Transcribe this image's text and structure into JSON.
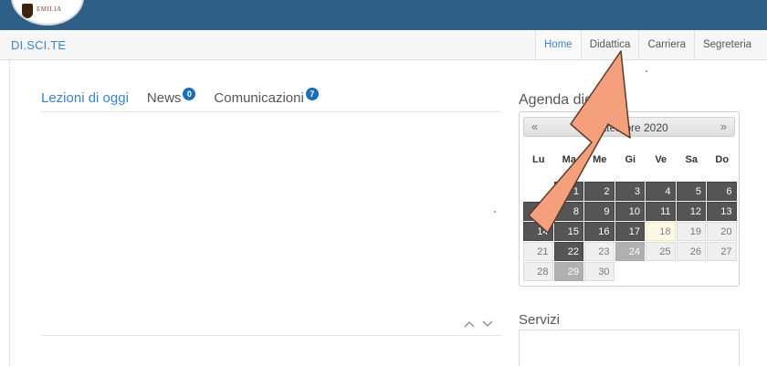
{
  "header": {
    "logo_text": "EMILIA",
    "brand": "DI.SCI.TE"
  },
  "nav": {
    "items": [
      "Home",
      "Didattica",
      "Carriera",
      "Segreteria"
    ],
    "active": "Home"
  },
  "tabs": {
    "lezioni": "Lezioni di oggi",
    "news": "News",
    "news_badge": "0",
    "comunicazioni": "Comunicazioni",
    "comunicazioni_badge": "7"
  },
  "agenda": {
    "title": "Agenda didattica",
    "prev_icon": "double-chevron-left",
    "next_icon": "double-chevron-right",
    "month_label": "Settembre 2020",
    "dows": [
      "Lu",
      "Ma",
      "Me",
      "Gi",
      "Ve",
      "Sa",
      "Do"
    ],
    "weeks": [
      [
        {
          "d": "",
          "s": "empty"
        },
        {
          "d": "1",
          "s": "dark"
        },
        {
          "d": "2",
          "s": "dark"
        },
        {
          "d": "3",
          "s": "dark"
        },
        {
          "d": "4",
          "s": "dark"
        },
        {
          "d": "5",
          "s": "dark"
        },
        {
          "d": "6",
          "s": "dark"
        }
      ],
      [
        {
          "d": "7",
          "s": "dark"
        },
        {
          "d": "8",
          "s": "dark"
        },
        {
          "d": "9",
          "s": "dark"
        },
        {
          "d": "10",
          "s": "dark"
        },
        {
          "d": "11",
          "s": "dark"
        },
        {
          "d": "12",
          "s": "dark"
        },
        {
          "d": "13",
          "s": "dark"
        }
      ],
      [
        {
          "d": "14",
          "s": "dark"
        },
        {
          "d": "15",
          "s": "dark"
        },
        {
          "d": "16",
          "s": "dark"
        },
        {
          "d": "17",
          "s": "dark"
        },
        {
          "d": "18",
          "s": "today"
        },
        {
          "d": "19",
          "s": "light"
        },
        {
          "d": "20",
          "s": "light"
        }
      ],
      [
        {
          "d": "21",
          "s": "light"
        },
        {
          "d": "22",
          "s": "dark"
        },
        {
          "d": "23",
          "s": "light"
        },
        {
          "d": "24",
          "s": "mid"
        },
        {
          "d": "25",
          "s": "light"
        },
        {
          "d": "26",
          "s": "light"
        },
        {
          "d": "27",
          "s": "light"
        }
      ],
      [
        {
          "d": "28",
          "s": "light"
        },
        {
          "d": "29",
          "s": "mid"
        },
        {
          "d": "30",
          "s": "light"
        }
      ]
    ]
  },
  "servizi": {
    "title": "Servizi"
  },
  "colors": {
    "topbar": "#2e5f86",
    "accent": "#3a85c8",
    "annotation_arrow": "#f4a07c"
  },
  "icons": {
    "collapse": "chevron-up-icon",
    "expand": "chevron-down-icon",
    "annotation": "pointer-arrow-icon"
  }
}
